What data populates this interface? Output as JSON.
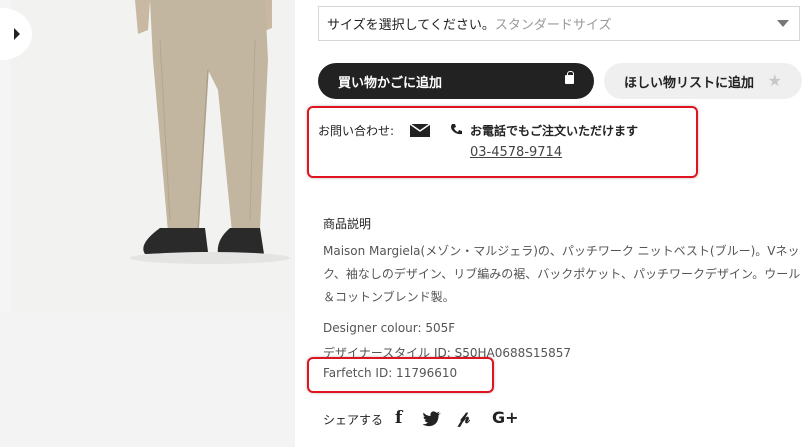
{
  "size_select": {
    "label": "サイズを選択してください。",
    "hint": "スタンダードサイズ"
  },
  "buttons": {
    "add_to_cart": "買い物かごに追加",
    "add_to_wishlist": "ほしい物リストに追加"
  },
  "contact": {
    "label": "お問い合わせ:",
    "phone_title": "お電話でもご注文いただけます",
    "phone_number": "03-4578-9714"
  },
  "description": {
    "title": "商品説明",
    "body": "Maison Margiela(メゾン・マルジェラ)の、パッチワーク ニットベスト(ブルー)。Vネック、袖なしのデザイン、リブ編みの裾、バックポケット、パッチワークデザイン。ウール＆コットンブレンド製。",
    "designer_colour": "Designer colour: 505F",
    "style_id": "デザイナースタイル ID: S50HA0688S15857",
    "farfetch_id": "Farfetch ID: 11796610"
  },
  "share": {
    "label": "シェアする",
    "icons": [
      "facebook-icon",
      "twitter-icon",
      "pinterest-icon",
      "google-plus-icon"
    ]
  },
  "colors": {
    "highlight": "#e0141e",
    "primary_button": "#222222",
    "secondary_button": "#efefef"
  }
}
